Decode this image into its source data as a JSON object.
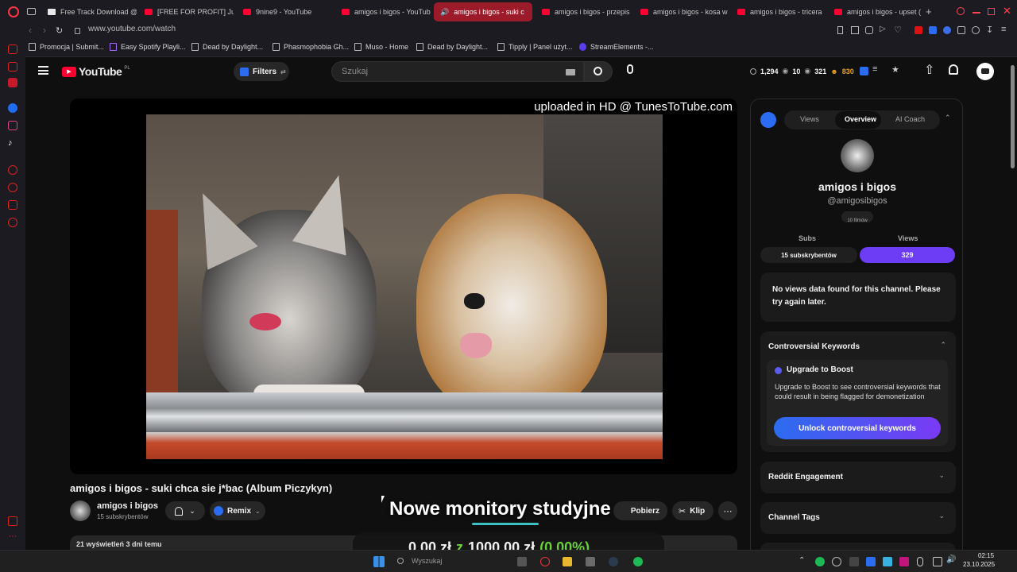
{
  "browser": {
    "tabs": [
      {
        "label": "Free Track Download @",
        "active": false
      },
      {
        "label": "[FREE FOR PROFIT] Juic",
        "active": false
      },
      {
        "label": "9nine9 - YouTube",
        "active": false
      },
      {
        "label": "amigos i bigos - YouTub",
        "active": false
      },
      {
        "label": "amigos i bigos - suki c",
        "active": true
      },
      {
        "label": "amigos i bigos - przepis",
        "active": false
      },
      {
        "label": "amigos i bigos - kosa w",
        "active": false
      },
      {
        "label": "amigos i bigos - tricera",
        "active": false
      },
      {
        "label": "amigos i bigos - upset (",
        "active": false
      }
    ],
    "new_tab": "+",
    "url": "www.youtube.com/watch",
    "bookmarks": [
      "Promocja | Submit...",
      "Easy Spotify Playli...",
      "Dead by Daylight...",
      "Phasmophobia Gh...",
      "Muso - Home",
      "Dead by Daylight...",
      "Tipply | Panel użyt...",
      "StreamElements -..."
    ]
  },
  "youtube": {
    "logo_text": "YouTube",
    "logo_region": "PL",
    "filters_label": "Filters",
    "search_placeholder": "Szukaj",
    "stats": {
      "views": "1,294",
      "videos": "10",
      "subs": "321",
      "followers": "830"
    }
  },
  "video": {
    "overlay_text": "uploaded in HD @ TunesToTube.com",
    "title": "amigos i bigos - suki chca sie j*bac (Album Piczykyn)",
    "channel_name": "amigos i bigos",
    "channel_subs": "15 subskrybentów",
    "remix_label": "Remix",
    "download_label": "Pobierz",
    "clip_label": "Klip",
    "views_line": "21 wyświetleń  3 dni temu",
    "stream_overlay_title": "Nowe monitory studyjne",
    "stream_overlay_amount": "0,00 zł",
    "stream_overlay_separator": "z",
    "stream_overlay_goal": "1000,00 zł",
    "stream_overlay_percent": "(0.00%)"
  },
  "panel": {
    "tabs": [
      "Views",
      "Overview",
      "AI Coach"
    ],
    "active_tab": "Overview",
    "channel_name": "amigos i bigos",
    "channel_handle": "@amigosibigos",
    "films_badge": "10 filmów",
    "subs_label": "Subs",
    "views_label": "Views",
    "subs_value": "15 subskrybentów",
    "views_value": "329",
    "no_views_msg": "No views data found for this channel. Please try again later.",
    "controversial_title": "Controversial Keywords",
    "upgrade_title": "Upgrade to Boost",
    "upgrade_text": "Upgrade to Boost to see controversial keywords that could result in being flagged for demonetization",
    "unlock_button": "Unlock controversial keywords",
    "reddit_title": "Reddit Engagement",
    "tags_title": "Channel Tags"
  },
  "taskbar": {
    "search_placeholder": "Wyszukaj",
    "time": "02:15",
    "date": "23.10.2025"
  },
  "colors": {
    "accent_red": "#ff0033",
    "active_tab": "#9b1b2a",
    "views_pill": "#6d3cf5",
    "goal_green": "#6ad13a"
  }
}
